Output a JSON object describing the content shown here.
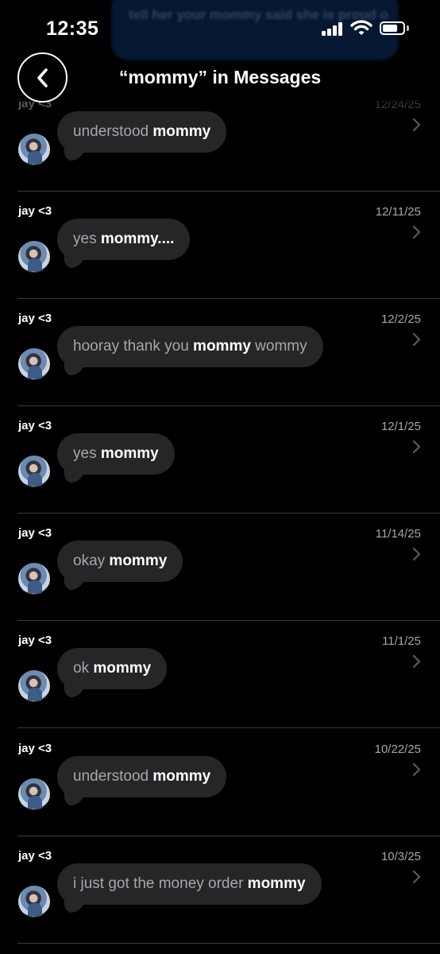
{
  "status_bar": {
    "time": "12:35",
    "signal_icon": "cellular-signal-icon",
    "wifi_icon": "wifi-icon",
    "battery_icon": "battery-icon",
    "battery_level": 0.75
  },
  "background_preview": {
    "text": "tell her your mommy said she is proud o"
  },
  "header": {
    "back_icon": "chevron-left-icon",
    "title": "“mommy” in Messages"
  },
  "theme": {
    "background": "#000000",
    "bubble": "#262629",
    "highlight_text": "#ffffff",
    "dim_text": "#a6a6ad",
    "divider": "#3a3a3c"
  },
  "results": [
    {
      "sender": "jay <3",
      "date": "12/24/25",
      "pre": "understood ",
      "match": "mommy",
      "post": ""
    },
    {
      "sender": "jay <3",
      "date": "12/11/25",
      "pre": "yes ",
      "match": "mommy....",
      "post": ""
    },
    {
      "sender": "jay <3",
      "date": "12/2/25",
      "pre": "hooray thank you ",
      "match": "mommy",
      "post": " wommy"
    },
    {
      "sender": "jay <3",
      "date": "12/1/25",
      "pre": "yes ",
      "match": "mommy",
      "post": ""
    },
    {
      "sender": "jay <3",
      "date": "11/14/25",
      "pre": "okay ",
      "match": "mommy",
      "post": ""
    },
    {
      "sender": "jay <3",
      "date": "11/1/25",
      "pre": "ok ",
      "match": "mommy",
      "post": ""
    },
    {
      "sender": "jay <3",
      "date": "10/22/25",
      "pre": "understood ",
      "match": "mommy",
      "post": ""
    },
    {
      "sender": "jay <3",
      "date": "10/3/25",
      "pre": "i just got the money order ",
      "match": "mommy",
      "post": ""
    }
  ]
}
